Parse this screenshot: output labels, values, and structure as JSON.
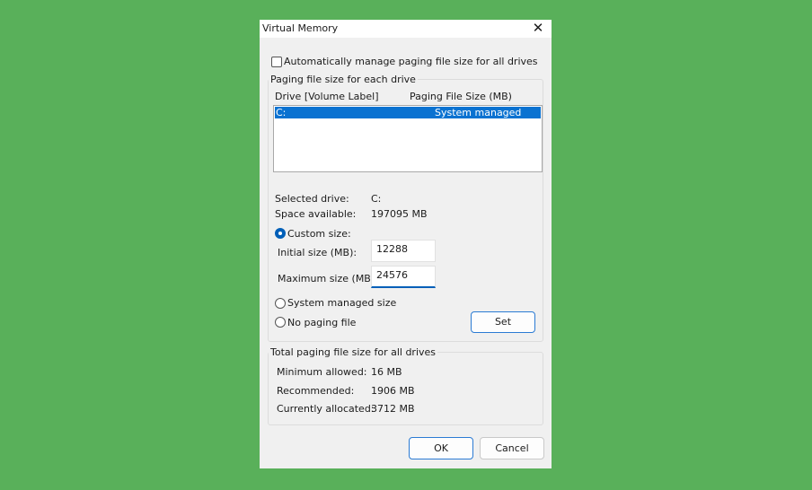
{
  "window": {
    "title": "Virtual Memory",
    "close_glyph": "✕"
  },
  "auto_manage": {
    "label": "Automatically manage paging file size for all drives",
    "checked": false
  },
  "per_drive": {
    "group_label": "Paging file size for each drive",
    "columns": [
      "Drive  [Volume Label]",
      "Paging File Size (MB)"
    ],
    "rows": [
      {
        "drive": "C:",
        "size": "System managed",
        "selected": true
      }
    ],
    "selected_drive_label": "Selected drive:",
    "selected_drive_value": "C:",
    "space_label": "Space available:",
    "space_value": "197095 MB",
    "custom_size_label": "Custom size:",
    "initial_label": "Initial size (MB):",
    "initial_value": "12288",
    "maximum_label": "Maximum size (MB):",
    "maximum_value": "24576",
    "system_managed_label": "System managed size",
    "no_paging_label": "No paging file",
    "selected_option": "custom",
    "set_label": "Set"
  },
  "totals": {
    "group_label": "Total paging file size for all drives",
    "min_label": "Minimum allowed:",
    "min_value": "16 MB",
    "rec_label": "Recommended:",
    "rec_value": "1906 MB",
    "alloc_label": "Currently allocated:",
    "alloc_value": "3712 MB"
  },
  "buttons": {
    "ok": "OK",
    "cancel": "Cancel"
  },
  "colors": {
    "background": "#59b05a",
    "selection": "#0a72d1",
    "accent": "#005fb8"
  }
}
